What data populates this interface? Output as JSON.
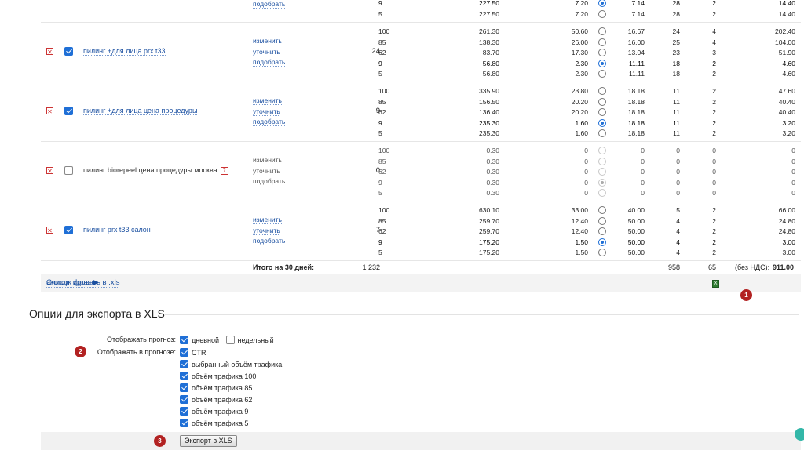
{
  "top_partial": {
    "action": "подобрать",
    "rows": [
      {
        "pos": "9",
        "bid": "227.50",
        "price": "7.20",
        "selected": true,
        "ctr": "7.14",
        "clicks": "28",
        "cpc": "2",
        "cost": "14.40"
      },
      {
        "pos": "5",
        "bid": "227.50",
        "price": "7.20",
        "selected": false,
        "ctr": "7.14",
        "clicks": "28",
        "cpc": "2",
        "cost": "14.40"
      }
    ]
  },
  "actions": {
    "change": "изменить",
    "refine": "уточнить",
    "pick": "подобрать"
  },
  "groups": [
    {
      "phrase": "пилинг +для лица prx t33",
      "checked": true,
      "link": true,
      "shows": "24",
      "disabled": false,
      "rows": [
        {
          "pos": "100",
          "bid": "261.30",
          "price": "50.60",
          "selected": false,
          "ctr": "16.67",
          "clicks": "24",
          "cpc": "4",
          "cost": "202.40"
        },
        {
          "pos": "85",
          "bid": "138.30",
          "price": "26.00",
          "selected": false,
          "ctr": "16.00",
          "clicks": "25",
          "cpc": "4",
          "cost": "104.00"
        },
        {
          "pos": "62",
          "bid": "83.70",
          "price": "17.30",
          "selected": false,
          "ctr": "13.04",
          "clicks": "23",
          "cpc": "3",
          "cost": "51.90"
        },
        {
          "pos": "9",
          "bid": "56.80",
          "price": "2.30",
          "selected": true,
          "ctr": "11.11",
          "clicks": "18",
          "cpc": "2",
          "cost": "4.60"
        },
        {
          "pos": "5",
          "bid": "56.80",
          "price": "2.30",
          "selected": false,
          "ctr": "11.11",
          "clicks": "18",
          "cpc": "2",
          "cost": "4.60"
        }
      ]
    },
    {
      "phrase": "пилинг +для лица цена процедуры",
      "checked": true,
      "link": true,
      "shows": "9",
      "disabled": false,
      "rows": [
        {
          "pos": "100",
          "bid": "335.90",
          "price": "23.80",
          "selected": false,
          "ctr": "18.18",
          "clicks": "11",
          "cpc": "2",
          "cost": "47.60"
        },
        {
          "pos": "85",
          "bid": "156.50",
          "price": "20.20",
          "selected": false,
          "ctr": "18.18",
          "clicks": "11",
          "cpc": "2",
          "cost": "40.40"
        },
        {
          "pos": "62",
          "bid": "136.40",
          "price": "20.20",
          "selected": false,
          "ctr": "18.18",
          "clicks": "11",
          "cpc": "2",
          "cost": "40.40"
        },
        {
          "pos": "9",
          "bid": "235.30",
          "price": "1.60",
          "selected": true,
          "ctr": "18.18",
          "clicks": "11",
          "cpc": "2",
          "cost": "3.20"
        },
        {
          "pos": "5",
          "bid": "235.30",
          "price": "1.60",
          "selected": false,
          "ctr": "18.18",
          "clicks": "11",
          "cpc": "2",
          "cost": "3.20"
        }
      ]
    },
    {
      "phrase": "пилинг biorepeel цена процедуры москва",
      "checked": false,
      "link": false,
      "shows": "0",
      "disabled": true,
      "question": "?",
      "rows": [
        {
          "pos": "100",
          "bid": "0.30",
          "price": "0",
          "selected": false,
          "ctr": "0",
          "clicks": "0",
          "cpc": "0",
          "cost": "0"
        },
        {
          "pos": "85",
          "bid": "0.30",
          "price": "0",
          "selected": false,
          "ctr": "0",
          "clicks": "0",
          "cpc": "0",
          "cost": "0"
        },
        {
          "pos": "62",
          "bid": "0.30",
          "price": "0",
          "selected": false,
          "ctr": "0",
          "clicks": "0",
          "cpc": "0",
          "cost": "0"
        },
        {
          "pos": "9",
          "bid": "0.30",
          "price": "0",
          "selected": true,
          "ctr": "0",
          "clicks": "0",
          "cpc": "0",
          "cost": "0"
        },
        {
          "pos": "5",
          "bid": "0.30",
          "price": "0",
          "selected": false,
          "ctr": "0",
          "clicks": "0",
          "cpc": "0",
          "cost": "0"
        }
      ]
    },
    {
      "phrase": "пилинг prx t33 салон",
      "checked": true,
      "link": true,
      "shows": "7",
      "disabled": false,
      "rows": [
        {
          "pos": "100",
          "bid": "630.10",
          "price": "33.00",
          "selected": false,
          "ctr": "40.00",
          "clicks": "5",
          "cpc": "2",
          "cost": "66.00"
        },
        {
          "pos": "85",
          "bid": "259.70",
          "price": "12.40",
          "selected": false,
          "ctr": "50.00",
          "clicks": "4",
          "cpc": "2",
          "cost": "24.80"
        },
        {
          "pos": "62",
          "bid": "259.70",
          "price": "12.40",
          "selected": false,
          "ctr": "50.00",
          "clicks": "4",
          "cpc": "2",
          "cost": "24.80"
        },
        {
          "pos": "9",
          "bid": "175.20",
          "price": "1.50",
          "selected": true,
          "ctr": "50.00",
          "clicks": "4",
          "cpc": "2",
          "cost": "3.00"
        },
        {
          "pos": "5",
          "bid": "175.20",
          "price": "1.50",
          "selected": false,
          "ctr": "50.00",
          "clicks": "4",
          "cpc": "2",
          "cost": "3.00"
        }
      ]
    }
  ],
  "totals": {
    "label": "Итого на 30 дней:",
    "shows": "1 232",
    "clicks": "958",
    "cpc": "65",
    "cost_label": "(без НДС):",
    "cost": "911.00"
  },
  "footer": {
    "phrase_list": "Список фраз ▶",
    "export_xls": "экспортировать в .xls"
  },
  "badges": {
    "b1": "1",
    "b2": "2",
    "b3": "3"
  },
  "export_options": {
    "title": "Опции для экспорта в XLS",
    "forecast_label": "Отображать прогноз:",
    "forecast_opts": [
      {
        "label": "дневной",
        "checked": true
      },
      {
        "label": "недельный",
        "checked": false
      }
    ],
    "show_label": "Отображать в прогнозе:",
    "show_opts": [
      {
        "label": "CTR",
        "checked": true
      },
      {
        "label": "выбранный объём трафика",
        "checked": true
      },
      {
        "label": "объём трафика 100",
        "checked": true
      },
      {
        "label": "объём трафика 85",
        "checked": true
      },
      {
        "label": "объём трафика 62",
        "checked": true
      },
      {
        "label": "объём трафика 9",
        "checked": true
      },
      {
        "label": "объём трафика 5",
        "checked": true
      }
    ],
    "button": "Экспорт в XLS"
  }
}
